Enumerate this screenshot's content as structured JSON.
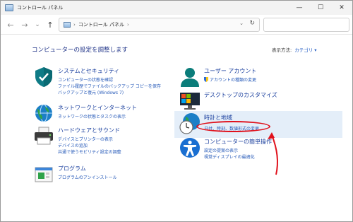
{
  "window": {
    "title": "コントロール パネル",
    "minimize_label": "—",
    "maximize_label": "☐",
    "close_label": "✕"
  },
  "nav": {
    "back_label": "←",
    "forward_label": "→",
    "recent_label": "⌄",
    "up_label": "↑",
    "breadcrumb_separator": "›",
    "breadcrumb": "コントロール パネル",
    "breadcrumb_end_separator": "›",
    "dropdown_label": "⌄",
    "refresh_label": "↻"
  },
  "main": {
    "heading": "コンピューターの設定を調整します",
    "view_by_label": "表示方法:",
    "view_by_value": "カテゴリ ▾"
  },
  "categories": [
    {
      "title": "システムとセキュリティ",
      "links": [
        "コンピューターの状態を確認",
        "ファイル履歴でファイルのバックアップ コピーを保存",
        "バックアップと復元 (Windows 7)"
      ],
      "icon": "shield-icon"
    },
    {
      "title": "ネットワークとインターネット",
      "links": [
        "ネットワークの状態とタスクの表示"
      ],
      "icon": "network-icon"
    },
    {
      "title": "ハードウェアとサウンド",
      "links": [
        "デバイスとプリンターの表示",
        "デバイスの追加",
        "共通で使うモビリティ設定の調整"
      ],
      "icon": "printer-icon"
    },
    {
      "title": "プログラム",
      "links": [
        "プログラムのアンインストール"
      ],
      "icon": "programs-icon"
    },
    {
      "title": "ユーザー アカウント",
      "links": [
        "アカウントの種類の変更"
      ],
      "icon": "user-icon"
    },
    {
      "title": "デスクトップのカスタマイズ",
      "links": [],
      "icon": "desktop-icon"
    },
    {
      "title": "時計と地域",
      "links": [
        "日付、時刻、数値形式の変更"
      ],
      "icon": "clock-globe-icon"
    },
    {
      "title": "コンピューターの簡単操作",
      "links": [
        "設定の提案の表示",
        "視覚ディスプレイの最適化"
      ],
      "icon": "accessibility-icon"
    }
  ],
  "colors": {
    "accent_link": "#2458b8",
    "title_link": "#1a3f9e",
    "annotation": "#e0111c",
    "hover_highlight": "#e4eef9"
  }
}
